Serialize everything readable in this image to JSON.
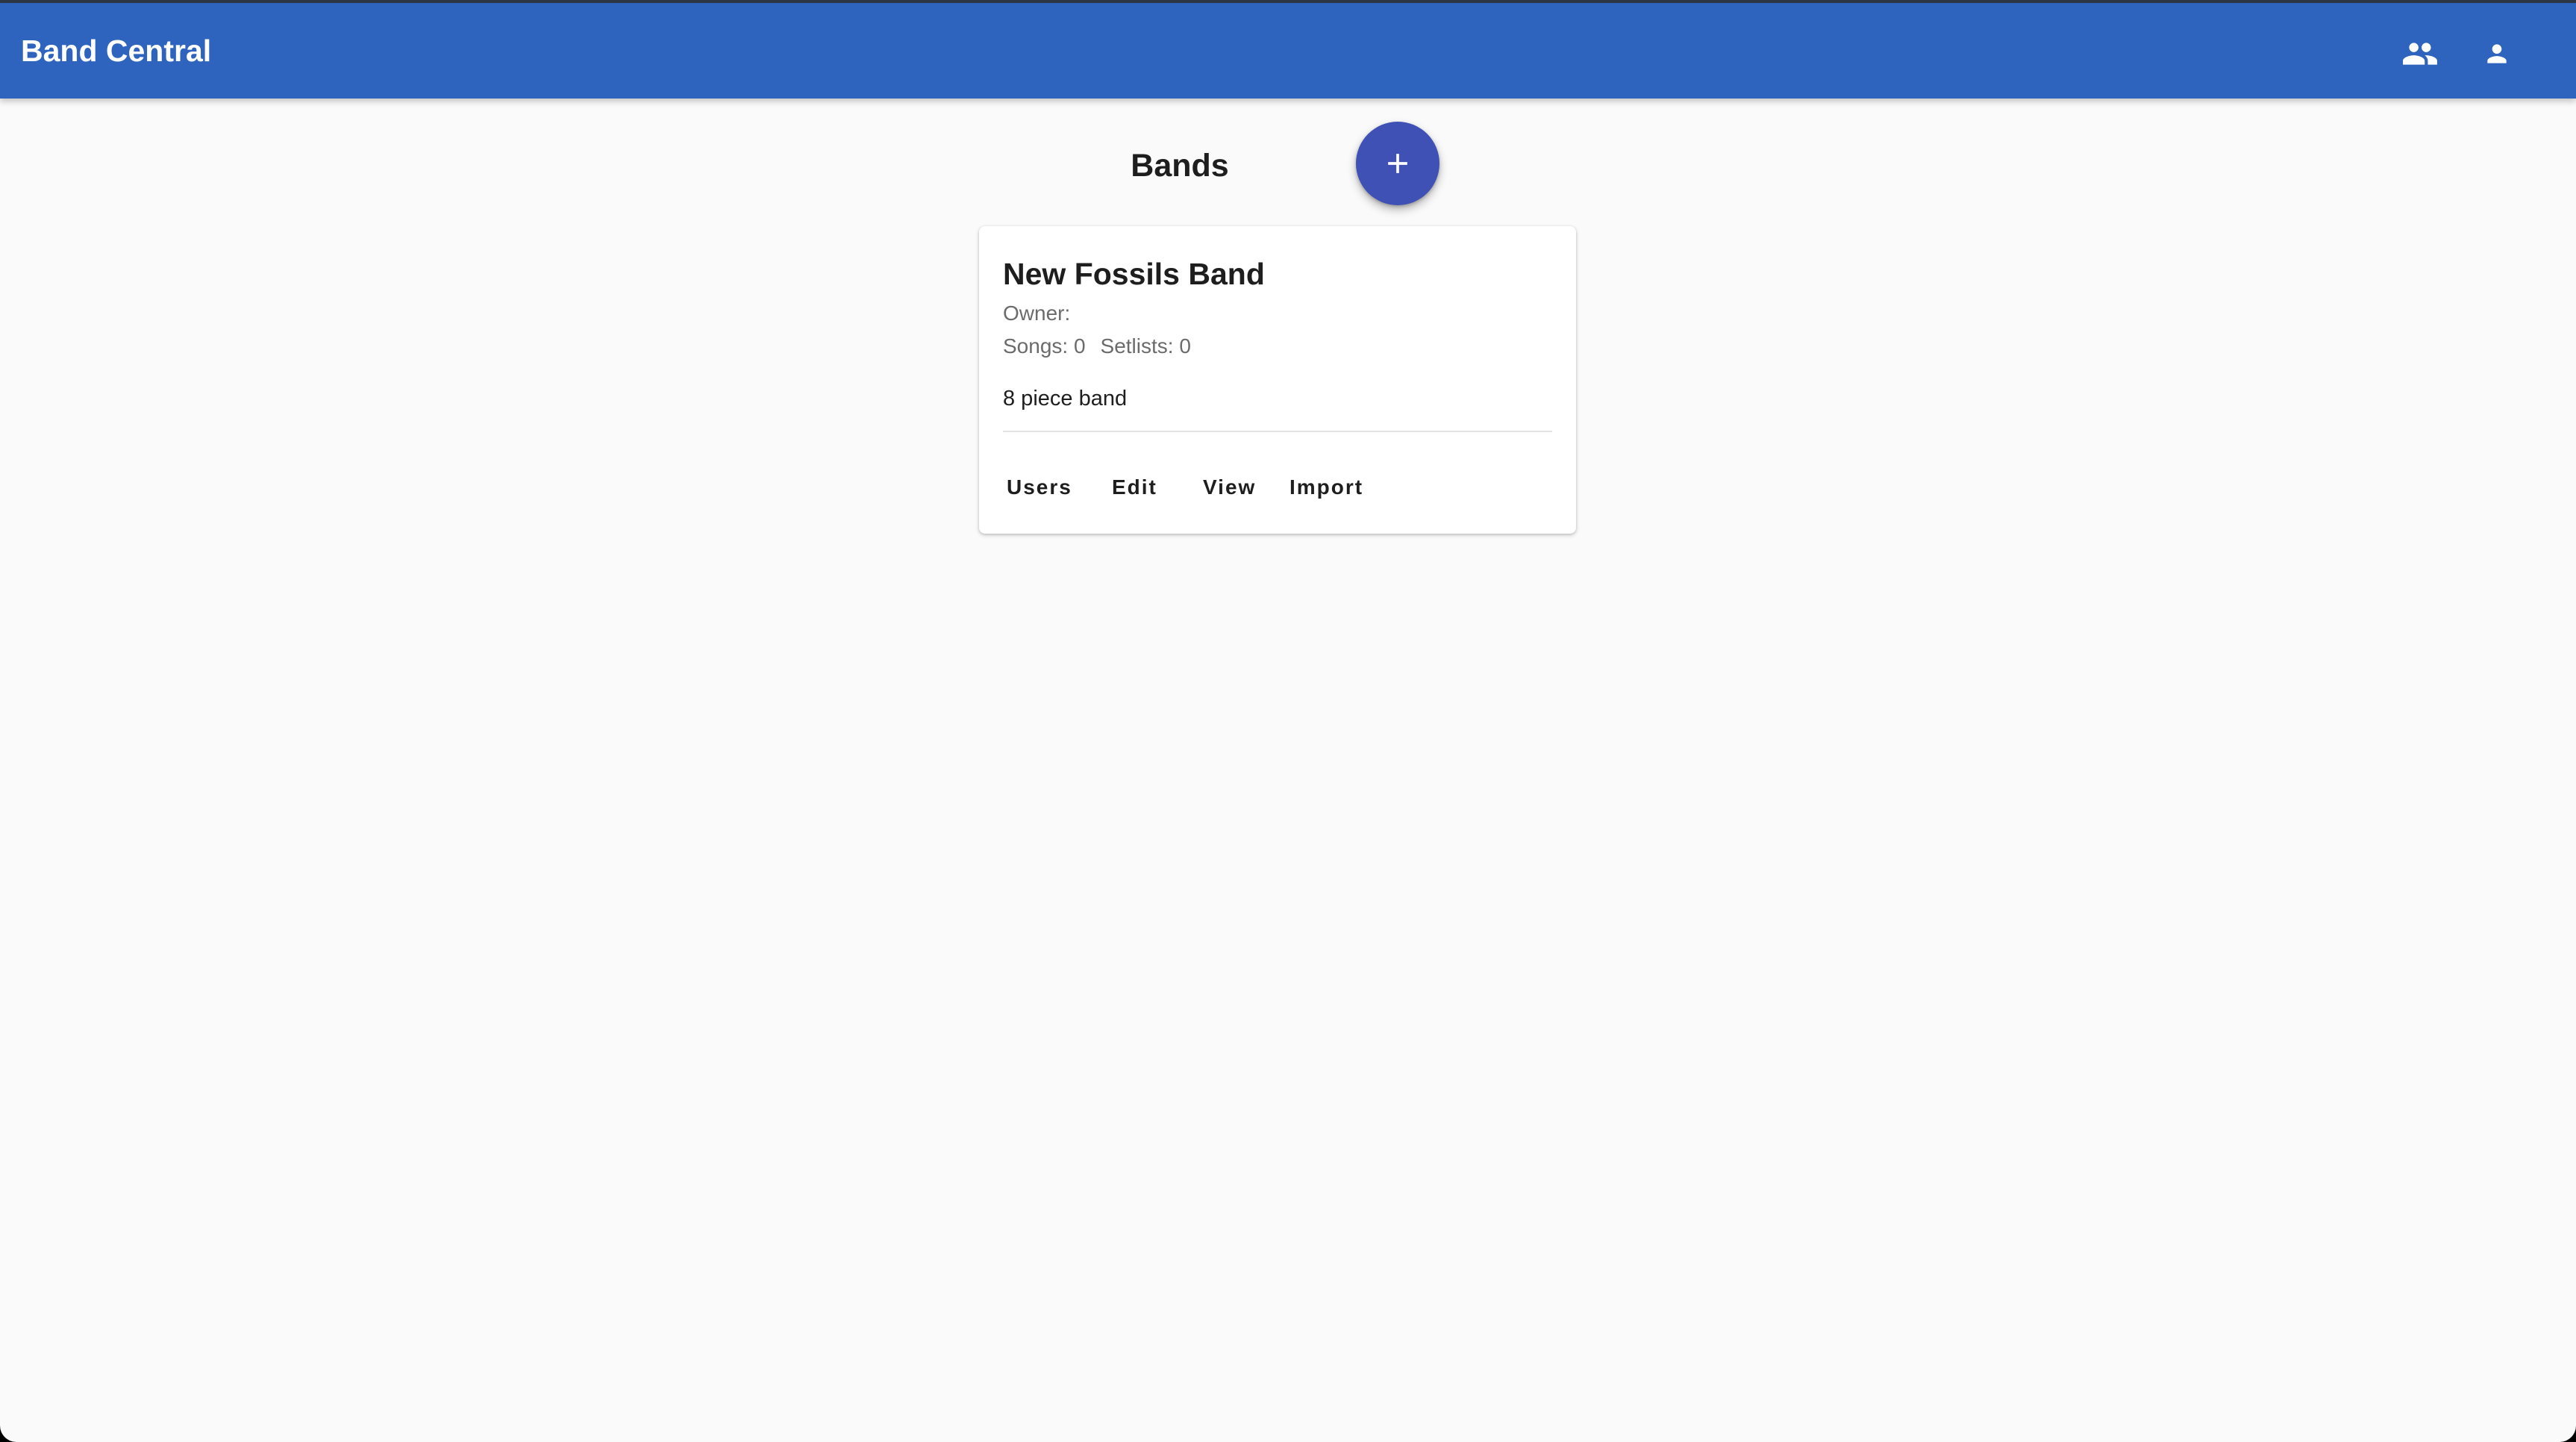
{
  "app": {
    "title": "Band Central",
    "brand_color": "#2e64be",
    "accent_color": "#3f51b5"
  },
  "toolbar": {
    "icons": [
      "people-icon",
      "person-icon"
    ]
  },
  "main": {
    "title": "Bands",
    "fab_icon": "add-icon"
  },
  "bands": [
    {
      "name": "New Fossils Band",
      "owner_label": "Owner:",
      "songs_label": "Songs: 0",
      "setlists_label": "Setlists: 0",
      "description": "8 piece band",
      "actions": {
        "users": "Users",
        "edit": "Edit",
        "view": "View",
        "import": "Import"
      }
    }
  ]
}
